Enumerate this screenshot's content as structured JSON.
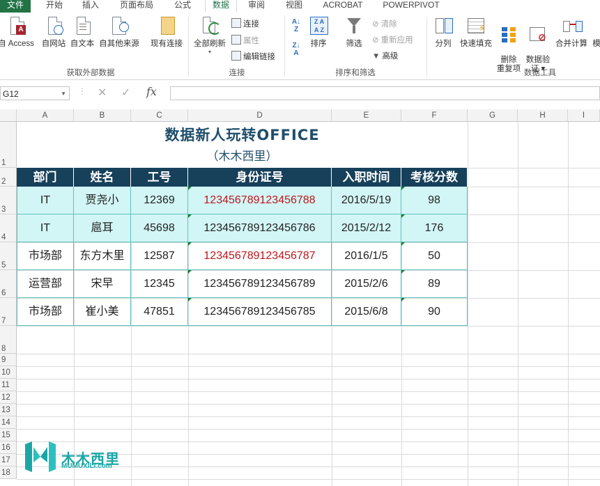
{
  "tabs": [
    "文件",
    "开始",
    "插入",
    "页面布局",
    "公式",
    "数据",
    "审阅",
    "视图",
    "ACROBAT",
    "POWERPIVOT"
  ],
  "active_tab": "数据",
  "ribbon": {
    "get_external": {
      "buttons": [
        "自 Access",
        "自网站",
        "自文本",
        "自其他来源",
        "现有连接"
      ],
      "label": "获取外部数据"
    },
    "connections": {
      "refresh_all": "全部刷新",
      "small": [
        "连接",
        "属性",
        "编辑链接"
      ],
      "label": "连接"
    },
    "sort_filter": {
      "sort": "排序",
      "filter": "筛选",
      "small": [
        "清除",
        "重新应用",
        "高级"
      ],
      "label": "排序和筛选"
    },
    "data_tools": {
      "buttons": [
        "分列",
        "快速填充",
        "删除\n重复项",
        "数据验\n证 ▾",
        "合并计算",
        "模"
      ],
      "label": "数据工具"
    }
  },
  "formula_bar": {
    "name_box": "G12",
    "fx": "fx",
    "value": ""
  },
  "columns": [
    "A",
    "B",
    "C",
    "D",
    "E",
    "F",
    "G",
    "H",
    "I"
  ],
  "rows": [
    "1",
    "2",
    "3",
    "4",
    "5",
    "6",
    "7",
    "8",
    "9",
    "10",
    "11",
    "12",
    "13",
    "14",
    "15",
    "16",
    "17",
    "18"
  ],
  "sheet": {
    "title": "数据新人玩转OFFICE",
    "subtitle": "（木木西里）",
    "headers": [
      "部门",
      "姓名",
      "工号",
      "身份证号",
      "入职时间",
      "考核分数"
    ],
    "records": [
      [
        "IT",
        "贾尧小",
        "12369",
        "123456789123456788",
        "2016/5/19",
        "98"
      ],
      [
        "IT",
        "扈耳",
        "45698",
        "123456789123456786",
        "2015/2/12",
        "176"
      ],
      [
        "市场部",
        "东方木里",
        "12587",
        "123456789123456787",
        "2016/1/5",
        "50"
      ],
      [
        "运营部",
        "宋早",
        "12345",
        "123456789123456789",
        "2015/2/6",
        "89"
      ],
      [
        "市场部",
        "崔小美",
        "47851",
        "123456789123456785",
        "2015/6/8",
        "90"
      ]
    ]
  },
  "colors": {
    "header_bg": "#17405a",
    "highlight_bg": "#d2f5f5",
    "duplicate_red": "#c0161b",
    "accent_green": "#217346"
  },
  "logo": {
    "name": "木木西里",
    "url_text": "MUMUXILI.com"
  }
}
